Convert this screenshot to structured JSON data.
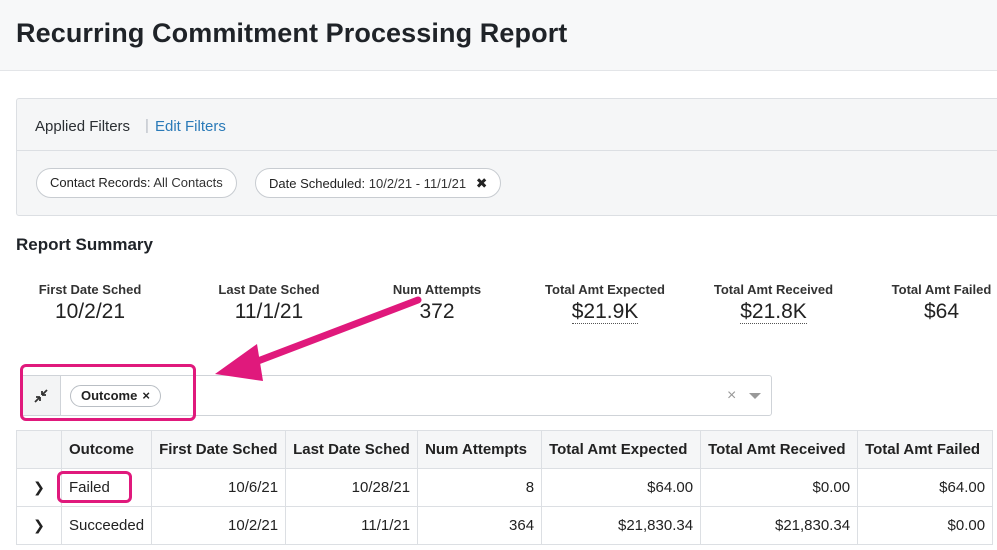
{
  "page": {
    "title": "Recurring Commitment Processing Report"
  },
  "filters": {
    "applied_label": "Applied Filters",
    "separator": "|",
    "edit_label": "Edit Filters",
    "pills": [
      {
        "key": "Contact Records:",
        "value": "All Contacts",
        "removable": false
      },
      {
        "key": "Date Scheduled:",
        "value": "10/2/21 - 11/1/21",
        "removable": true,
        "remove_glyph": "✖"
      }
    ]
  },
  "summary": {
    "title": "Report Summary",
    "metrics": [
      {
        "label": "First Date Sched",
        "value": "10/2/21"
      },
      {
        "label": "Last Date Sched",
        "value": "11/1/21"
      },
      {
        "label": "Num Attempts",
        "value": "372"
      },
      {
        "label": "Total Amt Expected",
        "value": "$21.9K"
      },
      {
        "label": "Total Amt Received",
        "value": "$21.8K"
      },
      {
        "label": "Total Amt Failed",
        "value": "$64"
      }
    ]
  },
  "grouping": {
    "chip_label": "Outcome",
    "chip_remove": "×",
    "clear_glyph": "×"
  },
  "table": {
    "columns": [
      "Outcome",
      "First Date Sched",
      "Last Date Sched",
      "Num Attempts",
      "Total Amt Expected",
      "Total Amt Received",
      "Total Amt Failed"
    ],
    "expand_glyph": "❯",
    "rows": [
      {
        "outcome": "Failed",
        "first": "10/6/21",
        "last": "10/28/21",
        "attempts": "8",
        "expected": "$64.00",
        "received": "$0.00",
        "failed": "$64.00"
      },
      {
        "outcome": "Succeeded",
        "first": "10/2/21",
        "last": "11/1/21",
        "attempts": "364",
        "expected": "$21,830.34",
        "received": "$21,830.34",
        "failed": "$0.00"
      }
    ]
  },
  "colors": {
    "annotation": "#e0197c",
    "link": "#2a7ab8"
  }
}
